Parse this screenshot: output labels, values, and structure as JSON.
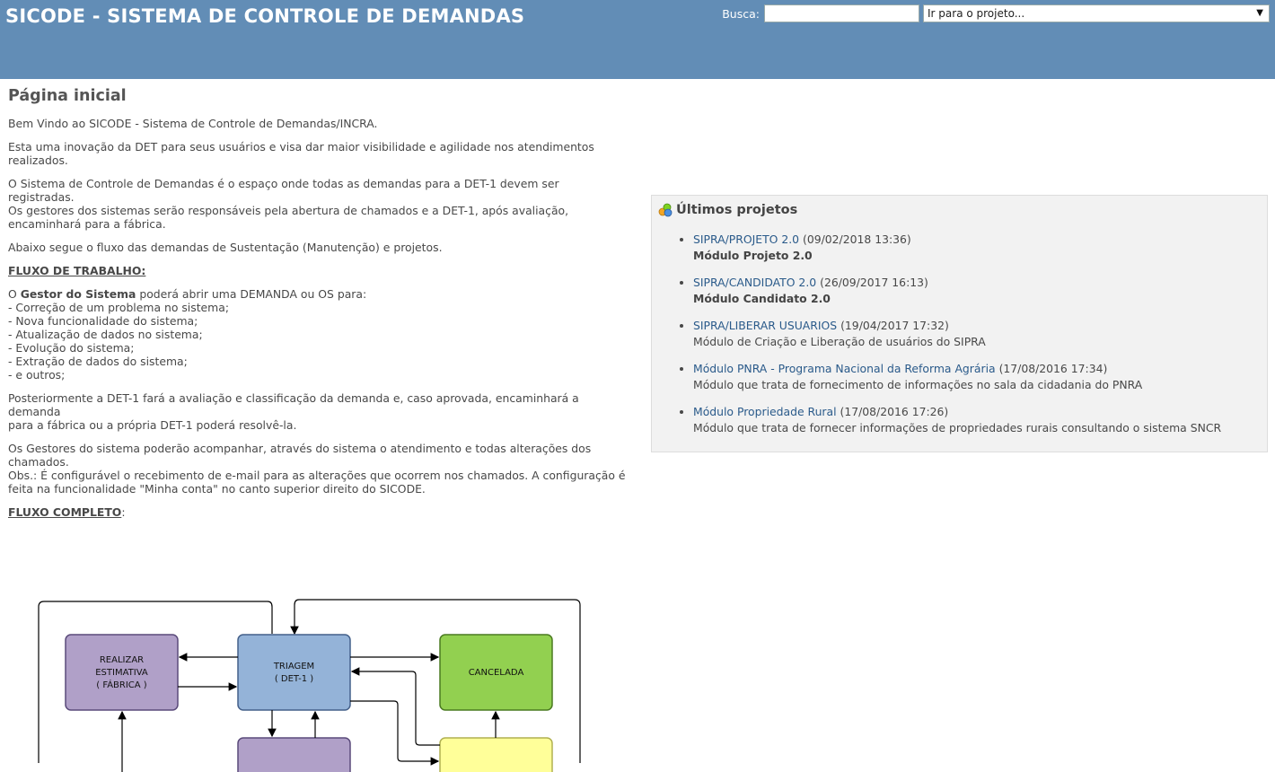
{
  "header": {
    "title": "SICODE - SISTEMA DE CONTROLE DE DEMANDAS",
    "search_label": "Busca:",
    "search_value": "",
    "project_select": "Ir para o projeto..."
  },
  "page": {
    "title": "Página inicial",
    "p1": "Bem Vindo ao SICODE - Sistema de Controle de Demandas/INCRA.",
    "p2a": "Esta uma inovação da DET para seus usuários e visa dar maior visibilidade e agilidade nos atendimentos",
    "p2b": "realizados.",
    "p3a": "O Sistema de Controle de Demandas é o espaço onde todas as demandas para a DET-1 devem ser registradas.",
    "p3b": "Os gestores dos sistemas serão responsáveis pela abertura de chamados e a DET-1, após avaliação,",
    "p3c": "encaminhará para a fábrica.",
    "p4": "Abaixo segue o fluxo das demandas de Sustentação (Manutenção) e projetos.",
    "fluxo_trabalho": "FLUXO DE TRABALHO:",
    "gestor_pre": "O",
    "gestor_bold": "Gestor do Sistema",
    "gestor_post": "poderá abrir uma DEMANDA ou OS para:",
    "items": [
      "- Correção de um problema no sistema;",
      "- Nova funcionalidade do sistema;",
      "- Atualização de dados no sistema;",
      "- Evolução do sistema;",
      "- Extração de dados do sistema;",
      "- e outros;"
    ],
    "p6a": "Posteriormente a DET-1 fará a avaliação e classificação da demanda e, caso aprovada, encaminhará a demanda",
    "p6b": "para a fábrica ou a própria DET-1 poderá resolvê-la.",
    "p7a": "Os Gestores do sistema poderão acompanhar, através do sistema o atendimento e todas alterações dos",
    "p7b": "chamados.",
    "p7c": "Obs.: É configurável o recebimento de e-mail para as alterações que ocorrem nos chamados. A configuração é",
    "p7d": "feita na funcionalidade \"Minha conta\" no canto superior direito do SICODE.",
    "fluxo_completo": "FLUXO COMPLETO",
    "fluxo_completo_colon": ":"
  },
  "diagram": {
    "box1_l1": "REALIZAR",
    "box1_l2": "ESTIMATIVA",
    "box1_l3": "( FÁBRICA )",
    "box2_l1": "TRIAGEM",
    "box2_l2": "( DET-1 )",
    "box3": "CANCELADA",
    "colors": {
      "purple": "#b0a0c8",
      "blue": "#94b3d8",
      "green": "#92d050",
      "yellow": "#ffff99"
    }
  },
  "projects": {
    "title": "Últimos projetos",
    "icon": "projects-icon",
    "items": [
      {
        "link": "SIPRA/PROJETO 2.0",
        "date": "(09/02/2018 13:36)",
        "desc": "Módulo Projeto 2.0",
        "bold": true
      },
      {
        "link": "SIPRA/CANDIDATO 2.0",
        "date": "(26/09/2017 16:13)",
        "desc": "Módulo Candidato 2.0",
        "bold": true
      },
      {
        "link": "SIPRA/LIBERAR USUARIOS",
        "date": "(19/04/2017 17:32)",
        "desc": "Módulo de Criação e Liberação de usuários do SIPRA",
        "bold": false
      },
      {
        "link": "Módulo PNRA - Programa Nacional da Reforma Agrária",
        "date": "(17/08/2016 17:34)",
        "desc": "Módulo que trata de fornecimento de informações no sala da cidadania do PNRA",
        "bold": false
      },
      {
        "link": "Módulo Propriedade Rural",
        "date": "(17/08/2016 17:26)",
        "desc": "Módulo que trata de fornecer informações de propriedades rurais consultando o sistema SNCR",
        "bold": false
      }
    ]
  }
}
